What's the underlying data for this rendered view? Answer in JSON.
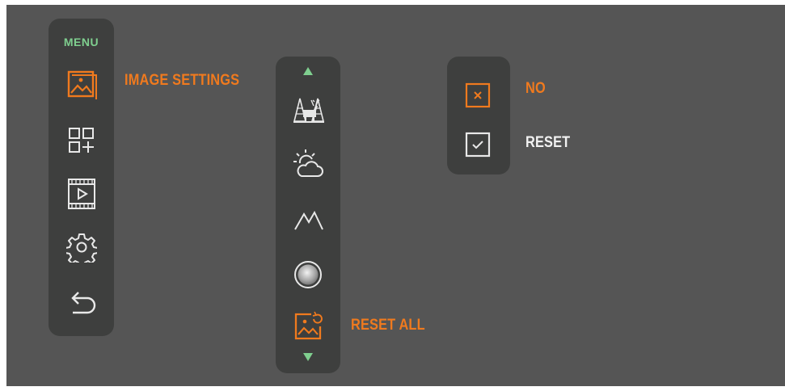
{
  "menu": {
    "title": "MENU",
    "items": [
      {
        "icon": "image-icon",
        "active": true
      },
      {
        "icon": "add-widget-icon",
        "active": false
      },
      {
        "icon": "video-icon",
        "active": false
      },
      {
        "icon": "gear-icon",
        "active": false
      },
      {
        "icon": "back-arrow-icon",
        "active": false
      }
    ],
    "active_label": "IMAGE SETTINGS"
  },
  "image_settings": {
    "items": [
      {
        "icon": "forest-deer-icon",
        "active": false
      },
      {
        "icon": "weather-icon",
        "active": false
      },
      {
        "icon": "mountain-icon",
        "active": false
      },
      {
        "icon": "gray-circle-icon",
        "active": false
      },
      {
        "icon": "reset-image-icon",
        "active": true
      }
    ],
    "active_label": "RESET ALL",
    "scroll_up_icon": "triangle-up-icon",
    "scroll_down_icon": "triangle-down-icon"
  },
  "confirm": {
    "no_label": "NO",
    "reset_label": "RESET",
    "no_icon": "x-box-icon",
    "reset_icon": "check-box-icon"
  },
  "colors": {
    "background": "#555555",
    "panel": "#3e3f3e",
    "accent": "#f07a1e",
    "menu_title": "#7fcf8f",
    "arrow": "#7fcf8f",
    "text": "#f2f2f2"
  }
}
